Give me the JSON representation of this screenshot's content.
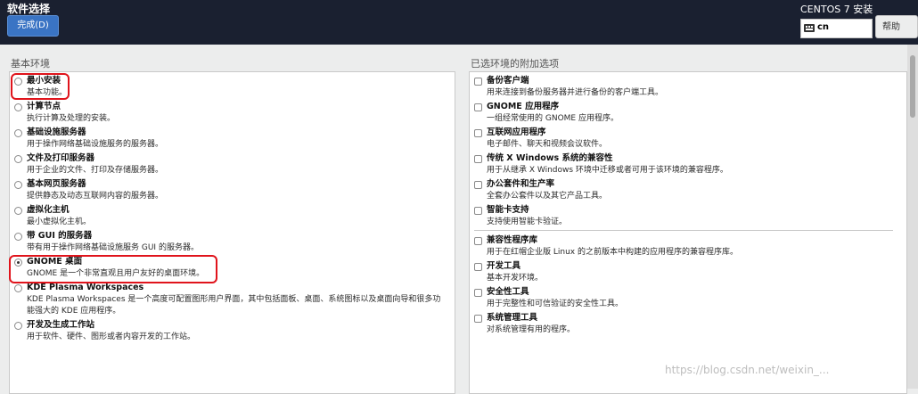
{
  "header": {
    "title": "软件选择",
    "done_label": "完成(D)",
    "product": "CENTOS 7 安装",
    "keyboard_layout": "cn",
    "help_label": "帮助"
  },
  "left": {
    "heading": "基本环境",
    "items": [
      {
        "title": "最小安装",
        "desc": "基本功能。",
        "selected": false
      },
      {
        "title": "计算节点",
        "desc": "执行计算及处理的安装。",
        "selected": false
      },
      {
        "title": "基础设施服务器",
        "desc": "用于操作网络基础设施服务的服务器。",
        "selected": false
      },
      {
        "title": "文件及打印服务器",
        "desc": "用于企业的文件、打印及存储服务器。",
        "selected": false
      },
      {
        "title": "基本网页服务器",
        "desc": "提供静态及动态互联网内容的服务器。",
        "selected": false
      },
      {
        "title": "虚拟化主机",
        "desc": "最小虚拟化主机。",
        "selected": false
      },
      {
        "title": "带 GUI 的服务器",
        "desc": "带有用于操作网络基础设施服务 GUI 的服务器。",
        "selected": false
      },
      {
        "title": "GNOME 桌面",
        "desc": "GNOME 是一个非常直观且用户友好的桌面环境。",
        "selected": true
      },
      {
        "title": "KDE Plasma Workspaces",
        "desc": "KDE Plasma Workspaces 是一个高度可配置图形用户界面，其中包括面板、桌面、系统图标以及桌面向导和很多功",
        "desc2": "能强大的 KDE 应用程序。",
        "selected": false
      },
      {
        "title": "开发及生成工作站",
        "desc": "用于软件、硬件、图形或者内容开发的工作站。",
        "selected": false
      }
    ]
  },
  "right": {
    "heading": "已选环境的附加选项",
    "items": [
      {
        "title": "备份客户端",
        "desc": "用来连接到备份服务器并进行备份的客户端工具。"
      },
      {
        "title": "GNOME 应用程序",
        "desc": "一组经常使用的 GNOME 应用程序。"
      },
      {
        "title": "互联网应用程序",
        "desc": "电子邮件、聊天和视频会议软件。"
      },
      {
        "title": "传统 X Windows 系统的兼容性",
        "desc": "用于从继承 X Windows 环境中迁移或者可用于该环境的兼容程序。"
      },
      {
        "title": "办公套件和生产率",
        "desc": "全套办公套件以及其它产品工具。"
      },
      {
        "title": "智能卡支持",
        "desc": "支持使用智能卡验证。"
      },
      {
        "title": "兼容性程序库",
        "desc": "用于在红帽企业版 Linux 的之前版本中构建的应用程序的兼容程序库。"
      },
      {
        "title": "开发工具",
        "desc": "基本开发环境。"
      },
      {
        "title": "安全性工具",
        "desc": "用于完整性和可信验证的安全性工具。"
      },
      {
        "title": "系统管理工具",
        "desc": "对系统管理有用的程序。"
      }
    ]
  },
  "watermark": "https://blog.csdn.net/weixin_...",
  "colors": {
    "header_bg": "#1a2030",
    "accent": "#3a74c4",
    "highlight": "#e0141c"
  }
}
